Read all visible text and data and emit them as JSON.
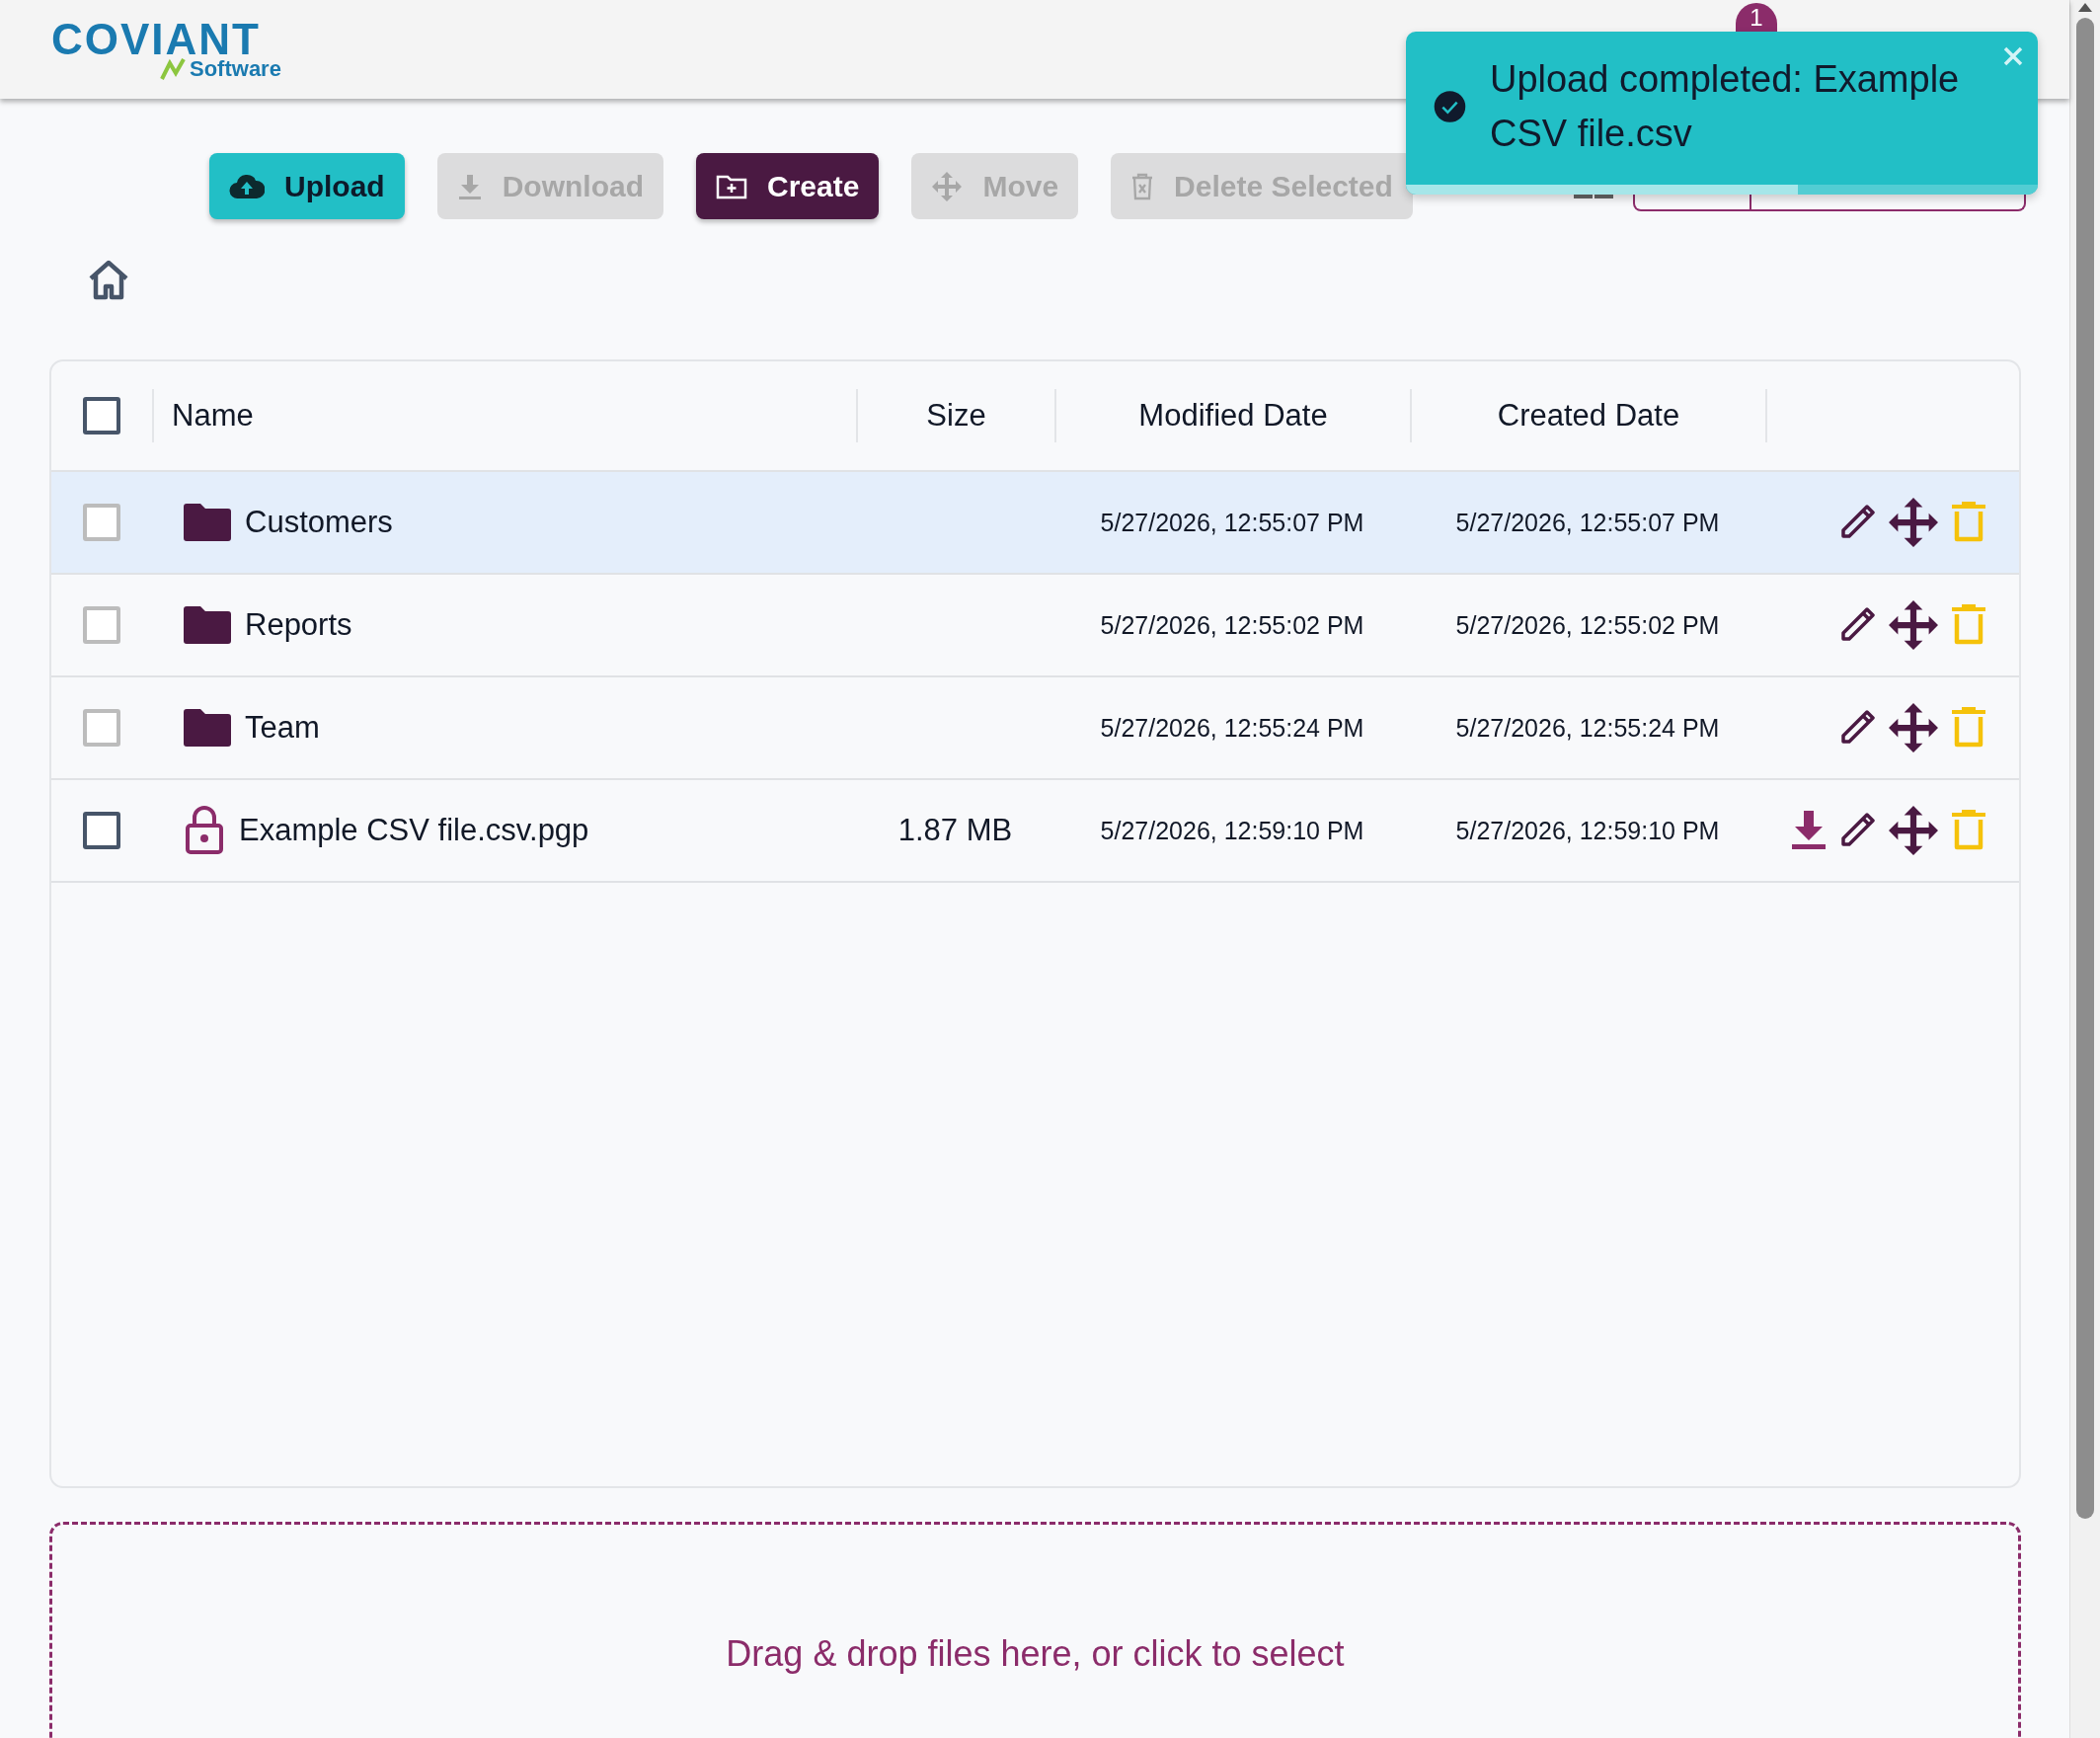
{
  "logo": {
    "brand": "COVIANT",
    "sub": "Software"
  },
  "notifications": {
    "count": "1"
  },
  "toolbar": [
    {
      "label": "Upload",
      "kind": "upload",
      "disabled": false
    },
    {
      "label": "Download",
      "kind": "download",
      "disabled": true
    },
    {
      "label": "Create",
      "kind": "create",
      "disabled": false
    },
    {
      "label": "Move",
      "kind": "move",
      "disabled": true
    },
    {
      "label": "Delete Selected",
      "kind": "delete",
      "disabled": true
    }
  ],
  "table": {
    "select_all": {
      "checked": false
    },
    "columns": [
      "Name",
      "Size",
      "Modified Date",
      "Created Date"
    ],
    "rows": [
      {
        "kind": "folder",
        "name": "Customers",
        "modified": "5/27/2026, 12:55:07 PM",
        "created": "5/27/2026, 12:55:07 PM",
        "checked": false,
        "disabled": true,
        "highlighted": true
      },
      {
        "kind": "folder",
        "name": "Reports",
        "modified": "5/27/2026, 12:55:02 PM",
        "created": "5/27/2026, 12:55:02 PM",
        "checked": false,
        "disabled": true,
        "highlighted": false
      },
      {
        "kind": "folder",
        "name": "Team",
        "modified": "5/27/2026, 12:55:24 PM",
        "created": "5/27/2026, 12:55:24 PM",
        "checked": false,
        "disabled": true,
        "highlighted": false
      },
      {
        "kind": "file",
        "name": "Example CSV file.csv.pgp",
        "size": "1.87 MB",
        "modified": "5/27/2026, 12:59:10 PM",
        "created": "5/27/2026, 12:59:10 PM",
        "checked": false,
        "disabled": false,
        "highlighted": false
      }
    ]
  },
  "toast": {
    "message": "Upload completed: Example CSV file.csv",
    "level": 0.62
  },
  "dropzone": {
    "text": "Drag & drop files here, or click to select"
  }
}
